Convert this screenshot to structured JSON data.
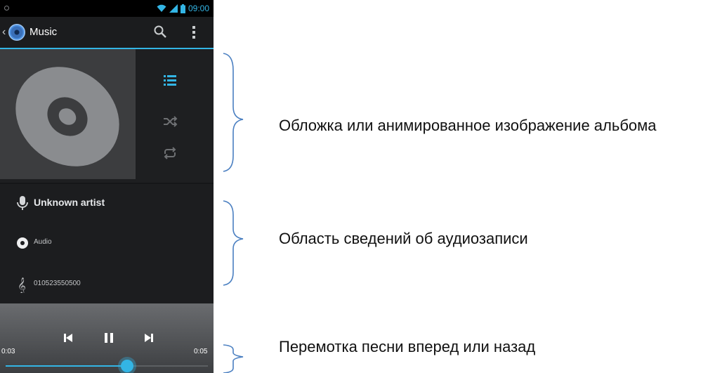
{
  "statusbar": {
    "time": "09:00"
  },
  "actionbar": {
    "title": "Music"
  },
  "track": {
    "artist": "Unknown artist",
    "album": "Audio",
    "title": "010523550500"
  },
  "player": {
    "elapsed": "0:03",
    "duration": "0:05",
    "progress_fraction": 0.6
  },
  "annotations": {
    "album_art": "Обложка или анимированное изображение альбома",
    "track_info": "Область сведений об аудиозаписи",
    "seek": "Перемотка песни вперед или назад"
  },
  "colors": {
    "accent": "#33b5e5",
    "brace": "#4a7fc1"
  }
}
